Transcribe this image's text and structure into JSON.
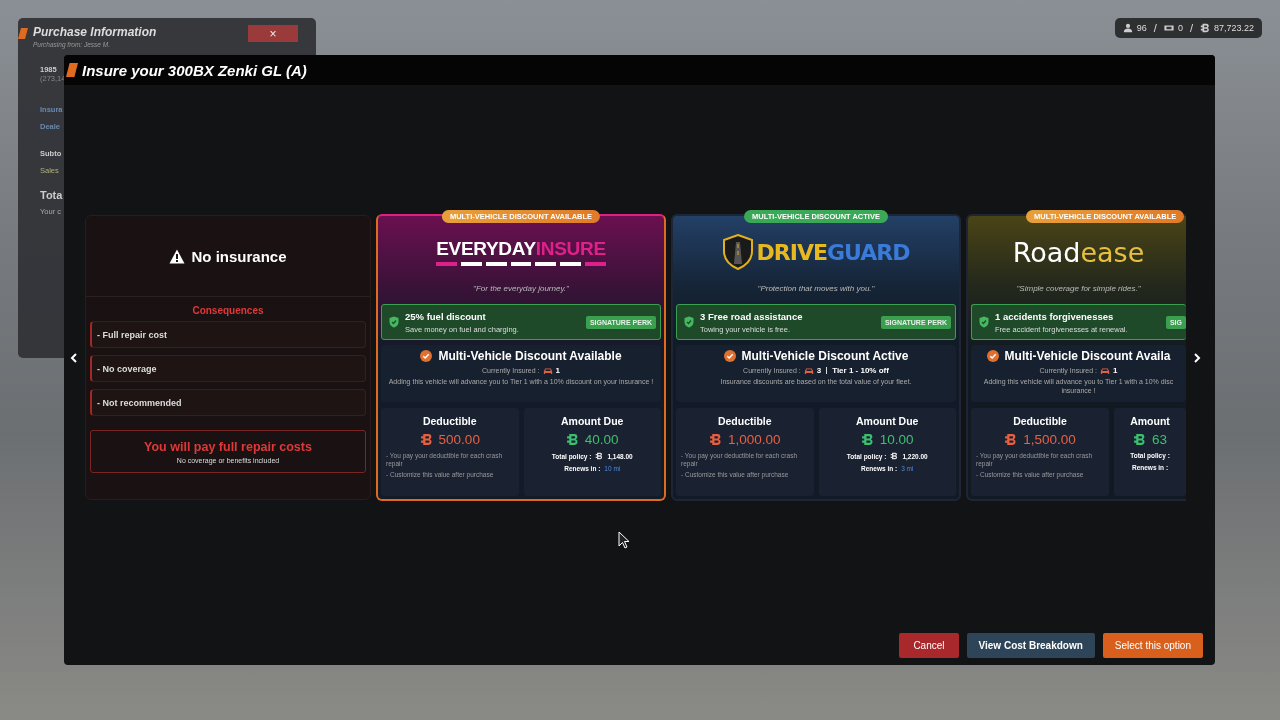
{
  "hud": {
    "separator": "/",
    "stats": [
      {
        "kind": "players",
        "value": "96"
      },
      {
        "kind": "tickets",
        "value": "0"
      },
      {
        "kind": "cash",
        "value": "87,723.22"
      }
    ]
  },
  "purchase_panel": {
    "title": "Purchase Information",
    "subtitle": "Purchasing from: Jesse M.",
    "close": "×",
    "rows": [
      {
        "kind": "vehicle",
        "text": "1985"
      },
      {
        "kind": "vehicle-sub",
        "text": "(273,14"
      },
      {
        "kind": "info",
        "text": "Insura"
      },
      {
        "kind": "info",
        "text": "Deale"
      },
      {
        "kind": "plain",
        "text": "Subto"
      },
      {
        "kind": "tax",
        "text": "Sales"
      },
      {
        "kind": "total",
        "text": "Tota"
      },
      {
        "kind": "note",
        "text": "Your c"
      }
    ]
  },
  "modal": {
    "title": "Insure your 300BX Zenki GL (A)",
    "no_insurance": {
      "title": "No insurance",
      "consequences_title": "Consequences",
      "consequences": [
        "- Full repair cost",
        "- No coverage",
        "- Not recommended"
      ],
      "warning": "You will pay full repair costs",
      "warning_note": "No coverage or benefits included"
    },
    "providers": [
      {
        "kind": "pink",
        "selected": true,
        "cut_off": false,
        "badge": {
          "kind": "available",
          "text": "MULTI-VEHICLE DISCOUNT AVAILABLE"
        },
        "logo": {
          "kind": "wordmark",
          "parts": [
            {
              "text": "EVERYDAY",
              "accent": false
            },
            {
              "text": "INSURE",
              "accent": true
            }
          ]
        },
        "tagline": "\"For the everyday journey.\"",
        "perk": {
          "title": "25% fuel discount",
          "text": "Save money on fuel and charging.",
          "tag": "SIGNATURE PERK"
        },
        "discount": {
          "title": "Multi-Vehicle Discount Available",
          "insured_label": "Currently Insured :",
          "insured_count": "1",
          "text": "Adding this vehicle will advance you to Tier 1 with a 10% discount on your insurance !"
        },
        "deductible": {
          "label": "Deductible",
          "amount": "500.00",
          "notes": [
            "- You pay your deductible for each crash repair",
            "- Customize this value after purchase"
          ]
        },
        "due": {
          "label": "Amount Due",
          "amount": "40.00",
          "total_label": "Total policy :",
          "total": "1,148.00",
          "renews_label": "Renews in :",
          "renews": "10 mi"
        }
      },
      {
        "kind": "blue",
        "selected": false,
        "cut_off": false,
        "badge": {
          "kind": "active",
          "text": "MULTI-VEHICLE DISCOUNT ACTIVE"
        },
        "logo": {
          "kind": "shield",
          "parts": [
            {
              "text": "DRIVE",
              "accent": false
            },
            {
              "text": "GUARD",
              "accent": true
            }
          ]
        },
        "tagline": "\"Protection that moves with you.\"",
        "perk": {
          "title": "3 Free road assistance",
          "text": "Towing your vehicle is free.",
          "tag": "SIGNATURE PERK"
        },
        "discount": {
          "title": "Multi-Vehicle Discount Active",
          "insured_label": "Currently Insured :",
          "insured_count": "3",
          "tier": "Tier 1 - 10% off",
          "text": "Insurance discounts are based on the total value of your fleet."
        },
        "deductible": {
          "label": "Deductible",
          "amount": "1,000.00",
          "notes": [
            "- You pay your deductible for each crash repair",
            "- Customize this value after purchase"
          ]
        },
        "due": {
          "label": "Amount Due",
          "amount": "10.00",
          "total_label": "Total policy :",
          "total": "1,220.00",
          "renews_label": "Renews in :",
          "renews": "3 mi"
        }
      },
      {
        "kind": "olive",
        "selected": false,
        "cut_off": true,
        "badge": {
          "kind": "available",
          "text": "MULTI-VEHICLE DISCOUNT AVAILABLE"
        },
        "logo": {
          "kind": "script",
          "parts": [
            {
              "text": "Road",
              "accent": false
            },
            {
              "text": "ease",
              "accent": true
            }
          ]
        },
        "tagline": "\"Simple coverage for simple rides.\"",
        "perk": {
          "title": "1 accidents forgivenesses",
          "text": "Free accident forgivenesses at renewal.",
          "tag": "SIG"
        },
        "discount": {
          "title": "Multi-Vehicle Discount Availa",
          "insured_label": "Currently Insured :",
          "insured_count": "1",
          "text": "Adding this vehicle will advance you to Tier 1 with a 10% disc insurance !"
        },
        "deductible": {
          "label": "Deductible",
          "amount": "1,500.00",
          "notes": [
            "- You pay your deductible for each crash repair",
            "- Customize this value after purchase"
          ]
        },
        "due": {
          "label": "Amount",
          "amount": "63",
          "total_label": "Total policy :",
          "renews_label": "Renews in :"
        }
      }
    ],
    "buttons": [
      {
        "kind": "cancel",
        "label": "Cancel"
      },
      {
        "kind": "secondary",
        "label": "View Cost Breakdown"
      },
      {
        "kind": "primary",
        "label": "Select this option"
      }
    ]
  }
}
